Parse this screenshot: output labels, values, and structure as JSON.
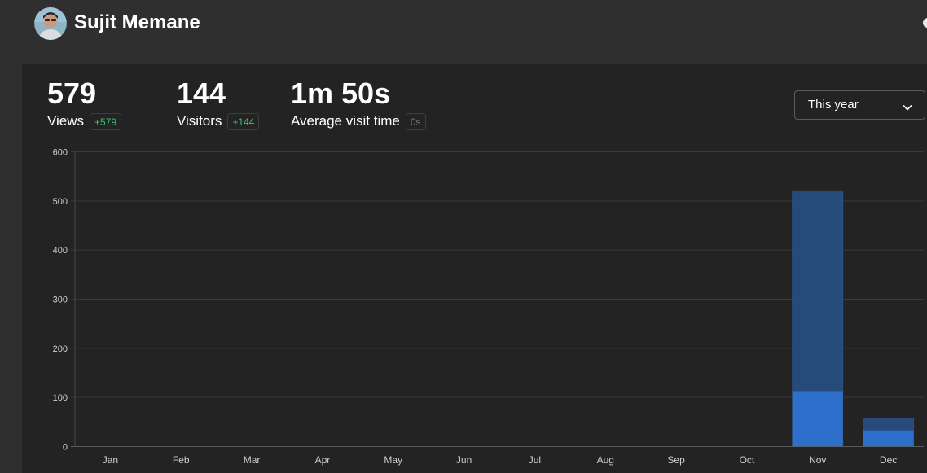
{
  "header": {
    "user_name": "Sujit Memane"
  },
  "metrics": [
    {
      "value": "579",
      "label": "Views",
      "change": "+579"
    },
    {
      "value": "144",
      "label": "Visitors",
      "change": "+144"
    },
    {
      "value": "1m 50s",
      "label": "Average visit time",
      "change": "0s"
    }
  ],
  "colors": {
    "positive_change": "#3fbf6f",
    "neutral_change": "#7a7a7a",
    "views_bar": "#264a7a",
    "visitors_bar": "#2e6fcb"
  },
  "range_select": {
    "selected": "This year",
    "icon": "chevron-down-icon"
  },
  "chart_data": {
    "type": "bar",
    "stacked": "overlay",
    "categories": [
      "Jan",
      "Feb",
      "Mar",
      "Apr",
      "May",
      "Jun",
      "Jul",
      "Aug",
      "Sep",
      "Oct",
      "Nov",
      "Dec"
    ],
    "series": [
      {
        "values": [
          0,
          0,
          0,
          0,
          0,
          0,
          0,
          0,
          0,
          0,
          520,
          57
        ]
      },
      {
        "values": [
          0,
          0,
          0,
          0,
          0,
          0,
          0,
          0,
          0,
          0,
          112,
          32
        ]
      }
    ],
    "y_ticks": [
      "0",
      "100",
      "200",
      "300",
      "400",
      "500",
      "600"
    ],
    "ylim": [
      0,
      600
    ],
    "grid": true
  }
}
